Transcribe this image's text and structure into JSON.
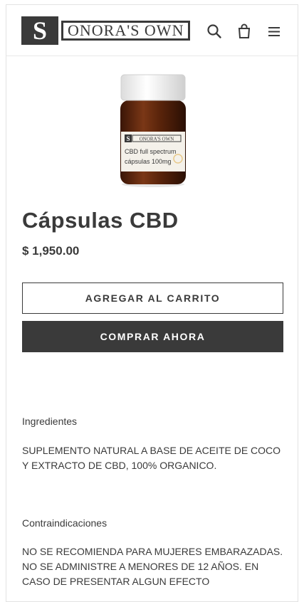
{
  "header": {
    "logo_letter": "S",
    "logo_text": "ONORA'S OWN",
    "icons": [
      "search-icon",
      "cart-icon",
      "menu-icon"
    ]
  },
  "product": {
    "image_label_brand": "SONORA'S OWN",
    "image_label_line1": "CBD full spectrum",
    "image_label_line2": "cápsulas 100mg",
    "title": "Cápsulas CBD",
    "price": "$ 1,950.00"
  },
  "buttons": {
    "add_to_cart": "AGREGAR AL CARRITO",
    "buy_now": "COMPRAR AHORA"
  },
  "description": {
    "ingredients_heading": "Ingredientes",
    "ingredients_text": "SUPLEMENTO NATURAL A BASE DE ACEITE DE COCO Y EXTRACTO DE CBD, 100% ORGANICO.",
    "contra_heading": "Contraindicaciones",
    "contra_text": "NO SE RECOMIENDA PARA MUJERES EMBARAZADAS. NO SE ADMINISTRE A MENORES DE 12 AÑOS. EN CASO DE PRESENTAR ALGUN EFECTO"
  },
  "colors": {
    "text": "#3a3a3a",
    "button_dark": "#3a3a3a",
    "bottle_amber": "#6b2e12",
    "border": "#e3e3e3"
  }
}
